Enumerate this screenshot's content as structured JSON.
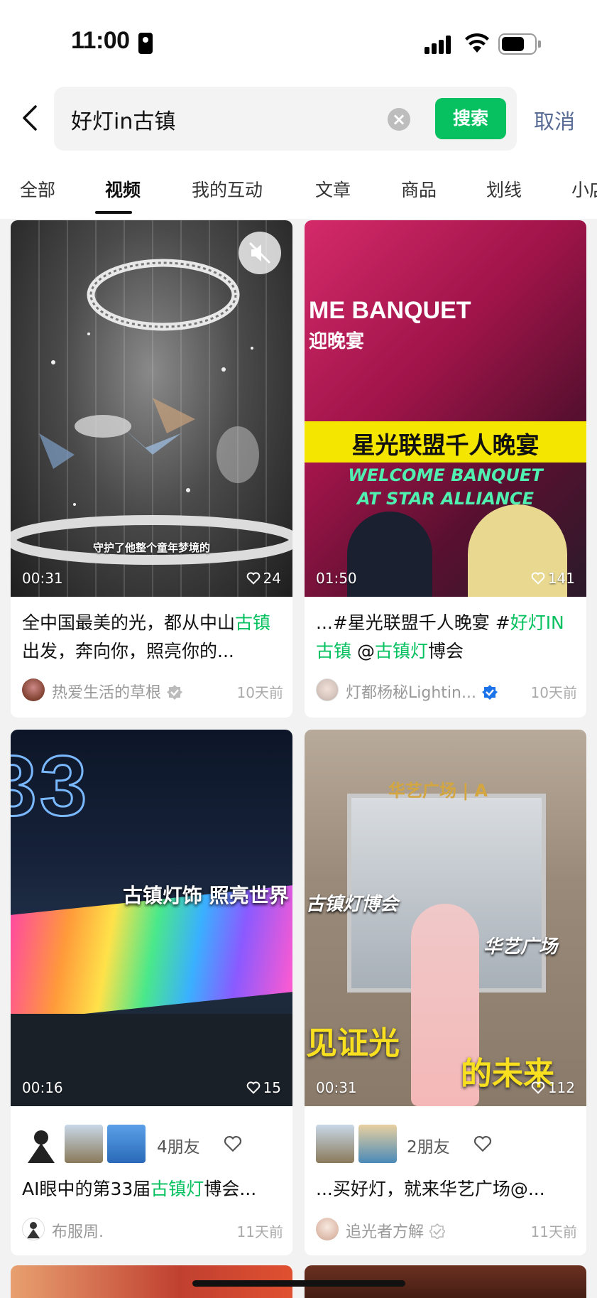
{
  "status_bar": {
    "time": "11:00"
  },
  "search": {
    "query": "好灯in古镇",
    "search_label": "搜索",
    "cancel_label": "取消"
  },
  "tabs": [
    {
      "label": "全部"
    },
    {
      "label": "视频"
    },
    {
      "label": "我的互动"
    },
    {
      "label": "文章"
    },
    {
      "label": "商品"
    },
    {
      "label": "划线"
    },
    {
      "label": "小店"
    }
  ],
  "active_tab": "视频",
  "cards": [
    {
      "duration": "00:31",
      "likes": "24",
      "overlay_caption": "守护了他整个童年梦境的",
      "title_parts": [
        {
          "text": "全中国最美的光，都从中山"
        },
        {
          "text": "古镇",
          "highlight": true
        },
        {
          "text": "出发，奔向你，照亮你的..."
        }
      ],
      "author": "热爱生活的草根",
      "date": "10天前"
    },
    {
      "duration": "01:50",
      "likes": "141",
      "overlay_lines": [
        "ME BANQUET",
        "迎晚宴",
        "星光联盟千人晚宴",
        "WELCOME BANQUET",
        "AT STAR ALLIANCE"
      ],
      "title_parts": [
        {
          "text": "...#星光联盟千人晚宴 #"
        },
        {
          "text": "好灯IN古镇",
          "highlight": true
        },
        {
          "text": " @"
        },
        {
          "text": "古镇灯",
          "highlight": true
        },
        {
          "text": "博会"
        }
      ],
      "author": "灯都杨秘Lightin...",
      "date": "10天前"
    },
    {
      "duration": "00:16",
      "likes": "15",
      "overlay_lines": [
        "33",
        "古镇灯饰 照亮世界"
      ],
      "friends": "4朋友",
      "title_parts": [
        {
          "text": "AI眼中的第33届"
        },
        {
          "text": "古镇灯",
          "highlight": true
        },
        {
          "text": "博会..."
        }
      ],
      "author": "布服周.",
      "date": "11天前"
    },
    {
      "duration": "00:31",
      "likes": "112",
      "overlay_lines": [
        "华艺广场 | A",
        "古镇灯博会",
        "华艺广场",
        "见证光",
        "的未来"
      ],
      "friends": "2朋友",
      "title_parts": [
        {
          "text": "...买好灯，就来华艺广场@..."
        }
      ],
      "author": "追光者方解",
      "date": "11天前"
    }
  ],
  "colors": {
    "accent": "#07c160",
    "link": "#576b95",
    "verified_blue": "#1a73e8"
  }
}
